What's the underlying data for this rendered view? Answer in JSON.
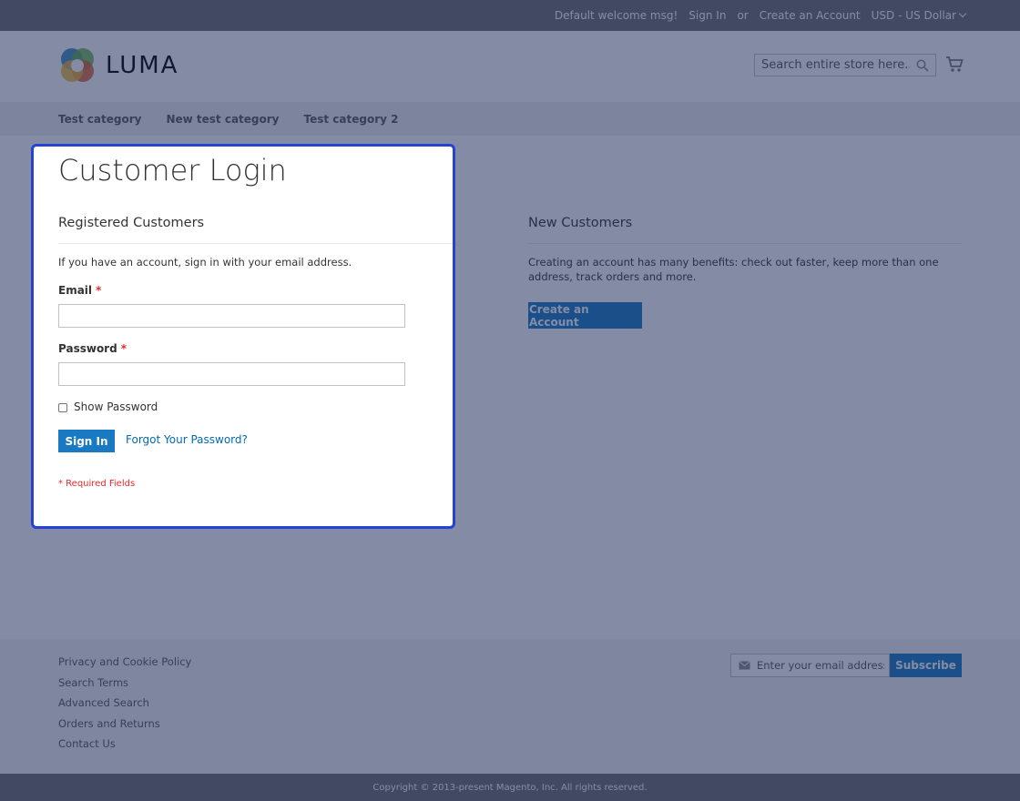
{
  "header": {
    "welcome": "Default welcome msg!",
    "sign_in": "Sign In",
    "or": "or",
    "create_account": "Create an Account",
    "currency": "USD - US Dollar"
  },
  "logo": {
    "text": "LUMA"
  },
  "search": {
    "placeholder": "Search entire store here..."
  },
  "nav": {
    "items": [
      "Test category",
      "New test category",
      "Test category 2"
    ]
  },
  "page": {
    "title": "Customer Login"
  },
  "registered": {
    "title": "Registered Customers",
    "intro": "If you have an account, sign in with your email address.",
    "email_label": "Email",
    "password_label": "Password",
    "required_marker": "*",
    "show_password": "Show Password",
    "sign_in_button": "Sign In",
    "forgot_password": "Forgot Your Password?",
    "required_note": "* Required Fields"
  },
  "new_customers": {
    "title": "New Customers",
    "text": "Creating an account has many benefits: check out faster, keep more than one address, track orders and more.",
    "button": "Create an Account"
  },
  "footer": {
    "links": [
      "Privacy and Cookie Policy",
      "Search Terms",
      "Advanced Search",
      "Orders and Returns",
      "Contact Us"
    ],
    "newsletter_placeholder": "Enter your email address",
    "subscribe": "Subscribe",
    "copyright": "Copyright © 2013-present Magento, Inc. All rights reserved."
  },
  "colors": {
    "primary": "#1979c3",
    "link": "#006bb4",
    "required": "#e02b27",
    "overlay": "#1e2d5a",
    "focus": "#2342d8"
  }
}
